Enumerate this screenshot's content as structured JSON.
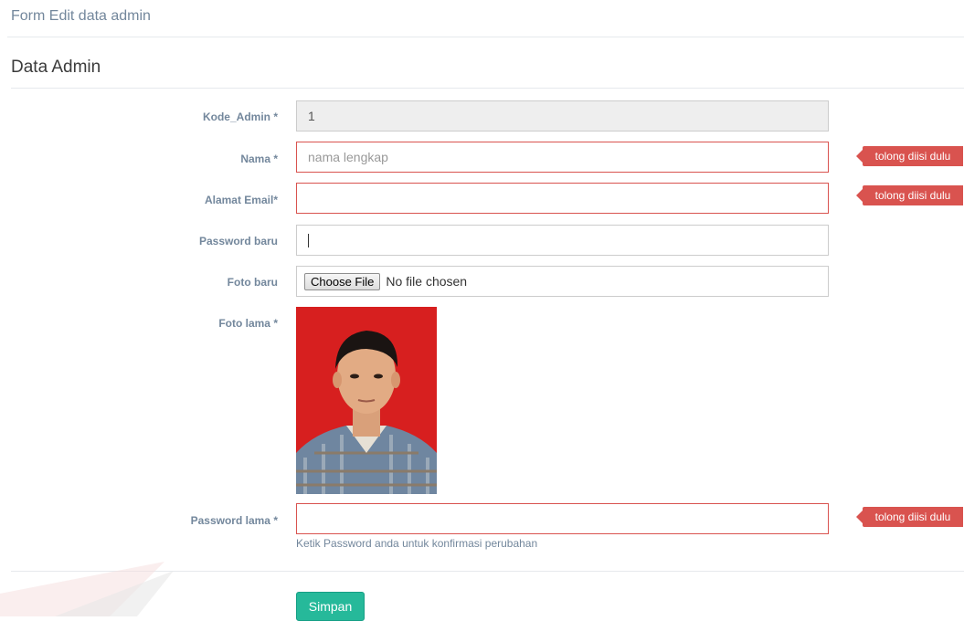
{
  "header": {
    "title": "Form Edit data admin"
  },
  "section": {
    "title": "Data Admin"
  },
  "form": {
    "kode_admin": {
      "label": "Kode_Admin *",
      "value": "1"
    },
    "nama": {
      "label": "Nama *",
      "placeholder": "nama lengkap",
      "error": "tolong diisi dulu"
    },
    "email": {
      "label": "Alamat Email*",
      "value": "",
      "error": "tolong diisi dulu"
    },
    "password_baru": {
      "label": "Password baru",
      "value": ""
    },
    "foto_baru": {
      "label": "Foto baru",
      "button": "Choose File",
      "status": "No file chosen"
    },
    "foto_lama": {
      "label": "Foto lama *"
    },
    "password_lama": {
      "label": "Password lama *",
      "value": "",
      "error": "tolong diisi dulu",
      "help": "Ketik Password anda untuk konfirmasi perubahan"
    }
  },
  "actions": {
    "save_label": "Simpan"
  },
  "colors": {
    "error": "#d9534f",
    "success": "#26b99a",
    "label": "#73879c"
  }
}
